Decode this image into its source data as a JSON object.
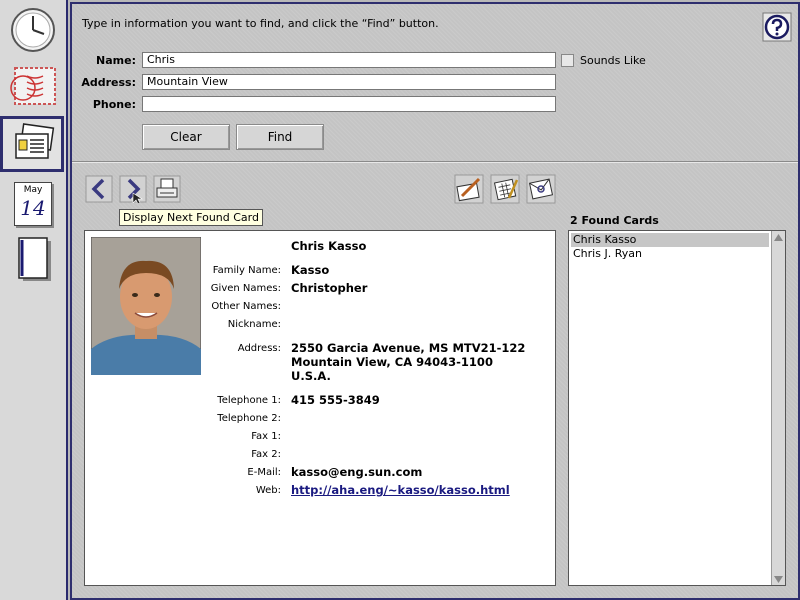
{
  "dock": {
    "items": [
      {
        "name": "clock",
        "label": ""
      },
      {
        "name": "mail",
        "label": ""
      },
      {
        "name": "cards",
        "label": ""
      },
      {
        "name": "calendar",
        "month": "May",
        "day": "14"
      },
      {
        "name": "notebook",
        "label": ""
      }
    ]
  },
  "search": {
    "instructions": "Type in information you want to find, and click the “Find” button.",
    "name_label": "Name:",
    "name_value": "Chris",
    "address_label": "Address:",
    "address_value": "Mountain View",
    "phone_label": "Phone:",
    "phone_value": "",
    "sounds_like_label": "Sounds Like",
    "clear_label": "Clear",
    "find_label": "Find"
  },
  "toolbar": {
    "tooltip": "Display Next Found Card"
  },
  "card": {
    "full_name": "Chris Kasso",
    "family_name_label": "Family Name:",
    "family_name": "Kasso",
    "given_names_label": "Given Names:",
    "given_names": "Christopher",
    "other_names_label": "Other Names:",
    "other_names": "",
    "nickname_label": "Nickname:",
    "nickname": "",
    "address_label": "Address:",
    "address_line1": "2550 Garcia Avenue, MS MTV21-122",
    "address_line2": "Mountain View, CA 94043-1100",
    "address_line3": "U.S.A.",
    "tel1_label": "Telephone 1:",
    "tel1": "415 555-3849",
    "tel2_label": "Telephone 2:",
    "tel2": "",
    "fax1_label": "Fax 1:",
    "fax1": "",
    "fax2_label": "Fax 2:",
    "fax2": "",
    "email_label": "E-Mail:",
    "email": "kasso@eng.sun.com",
    "web_label": "Web:",
    "web": "http://aha.eng/~kasso/kasso.html"
  },
  "results": {
    "title": "2 Found Cards",
    "items": [
      "Chris Kasso",
      "Chris J. Ryan"
    ]
  },
  "colors": {
    "accent": "#2e2e6e",
    "selection": "#c6c6c6"
  }
}
